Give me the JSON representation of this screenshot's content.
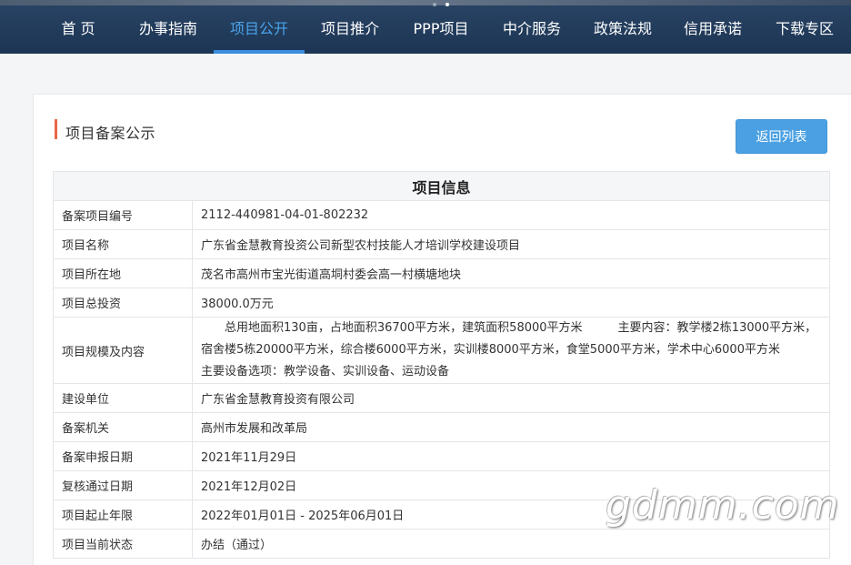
{
  "nav": {
    "items": [
      {
        "label": "首 页"
      },
      {
        "label": "办事指南"
      },
      {
        "label": "项目公开"
      },
      {
        "label": "项目推介"
      },
      {
        "label": "PPP项目"
      },
      {
        "label": "中介服务"
      },
      {
        "label": "政策法规"
      },
      {
        "label": "信用承诺"
      },
      {
        "label": "下载专区"
      }
    ],
    "active_index": 2
  },
  "page": {
    "title": "项目备案公示",
    "back_button": "返回列表"
  },
  "table": {
    "header": "项目信息",
    "rows": [
      {
        "label": "备案项目编号",
        "value": "2112-440981-04-01-802232"
      },
      {
        "label": "项目名称",
        "value": "广东省金慧教育投资公司新型农村技能人才培训学校建设项目"
      },
      {
        "label": "项目所在地",
        "value": "茂名市高州市宝光街道高垌村委会高一村横塘地块"
      },
      {
        "label": "项目总投资",
        "value": "38000.0万元"
      },
      {
        "label": "项目规模及内容",
        "value": "　　总用地面积130亩，占地面积36700平方米，建筑面积58000平方米　　　主要内容：教学楼2栋13000平方米，宿舍楼5栋20000平方米，综合楼6000平方米，实训楼8000平方米，食堂5000平方米，学术中心6000平方米　　　主要设备选项：教学设备、实训设备、运动设备"
      },
      {
        "label": "建设单位",
        "value": "广东省金慧教育投资有限公司"
      },
      {
        "label": "备案机关",
        "value": "高州市发展和改革局"
      },
      {
        "label": "备案申报日期",
        "value": "2021年11月29日"
      },
      {
        "label": "复核通过日期",
        "value": "2021年12月02日"
      },
      {
        "label": "项目起止年限",
        "value": "2022年01月01日 - 2025年06月01日"
      },
      {
        "label": "项目当前状态",
        "value": "办结（通过）"
      }
    ]
  },
  "watermark": "gdmm.com",
  "colors": {
    "nav_bg": "#1c3554",
    "nav_active": "#4aa3ea",
    "accent_bar": "#e9674a",
    "button_bg": "#4aa0e2"
  }
}
